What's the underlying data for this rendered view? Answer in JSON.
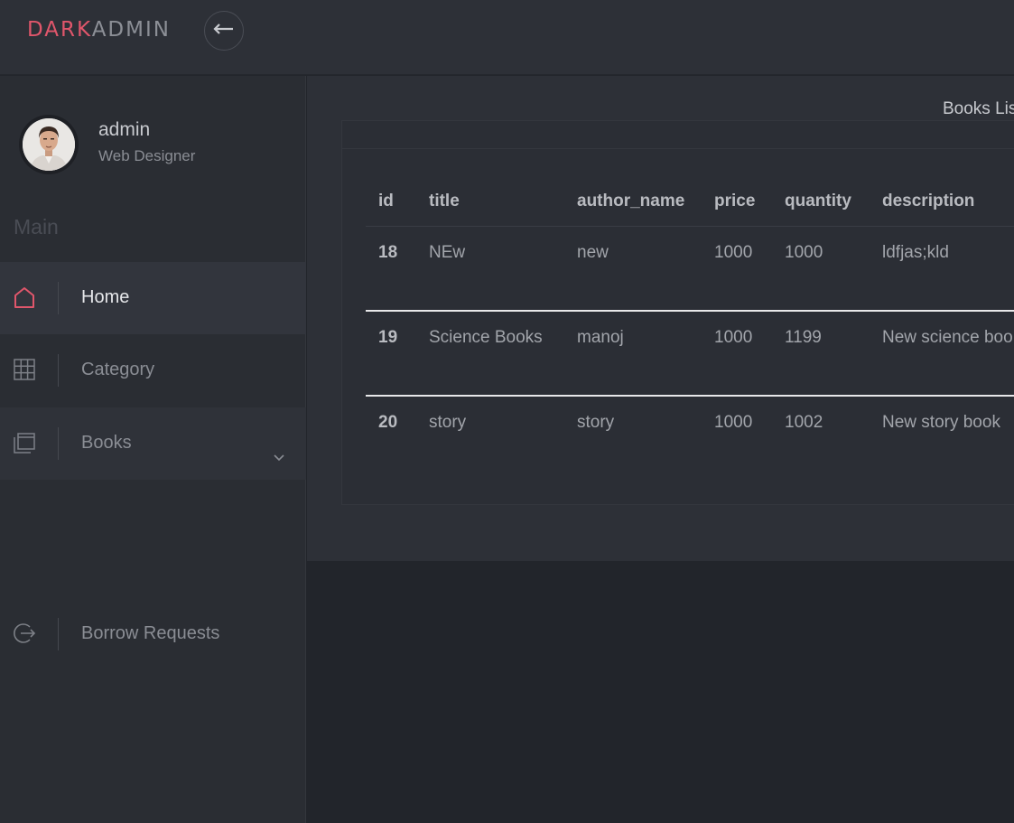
{
  "brand": {
    "part1": "DARK",
    "part2": "ADMIN"
  },
  "colors": {
    "accent": "#e0566b",
    "background": "#22252b",
    "panel": "#2d3037"
  },
  "header": {
    "back_icon": "arrow-left-icon"
  },
  "profile": {
    "name": "admin",
    "role": "Web Designer"
  },
  "sidebar": {
    "section_label": "Main",
    "items": [
      {
        "label": "Home",
        "icon": "home-icon",
        "active": true
      },
      {
        "label": "Category",
        "icon": "grid-icon",
        "active": false
      },
      {
        "label": "Books",
        "icon": "window-stack-icon",
        "active": false,
        "has_submenu": true
      },
      {
        "label": "Borrow Requests",
        "icon": "logout-circle-icon",
        "active": false
      }
    ]
  },
  "main": {
    "heading": "Books List",
    "table": {
      "columns": [
        "id",
        "title",
        "author_name",
        "price",
        "quantity",
        "description"
      ],
      "rows": [
        {
          "id": "18",
          "title": "NEw",
          "author_name": "new",
          "price": "1000",
          "quantity": "1000",
          "description": "ldfjas;kld"
        },
        {
          "id": "19",
          "title": "Science Books",
          "author_name": "manoj",
          "price": "1000",
          "quantity": "1199",
          "description": "New science book"
        },
        {
          "id": "20",
          "title": "story",
          "author_name": "story",
          "price": "1000",
          "quantity": "1002",
          "description": "New story book"
        }
      ]
    }
  }
}
